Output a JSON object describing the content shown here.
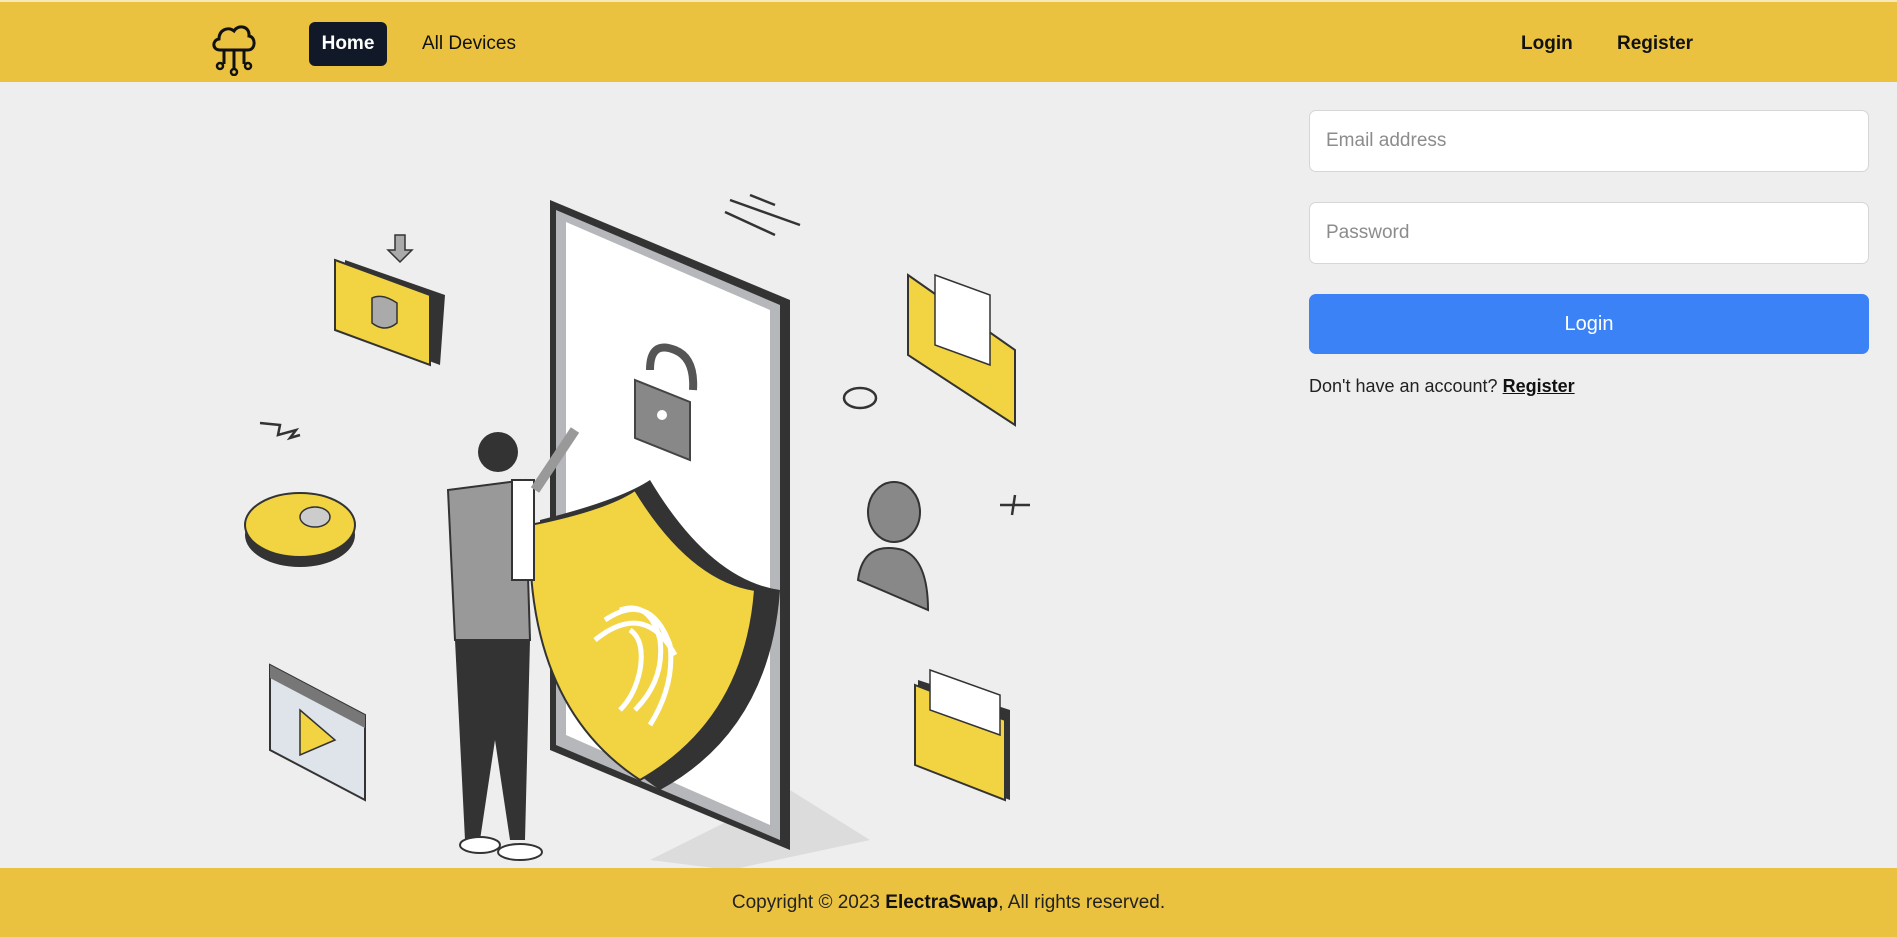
{
  "nav": {
    "logo_icon": "cloud-network-icon",
    "home_label": "Home",
    "devices_label": "All Devices",
    "login_label": "Login",
    "register_label": "Register"
  },
  "hero": {
    "illustration": "mobile-security-fingerprint-illustration"
  },
  "login_form": {
    "email_placeholder": "Email address",
    "password_placeholder": "Password",
    "submit_label": "Login",
    "signup_prompt": "Don't have an account?",
    "signup_link": "Register"
  },
  "footer": {
    "copyright_prefix": "Copyright © 2023",
    "brand": "ElectraSwap",
    "rights": ", All rights reserved."
  },
  "colors": {
    "bar": "#ebc240",
    "accent_button": "#3b82f6",
    "nav_active": "#111827",
    "background": "#eeeeee"
  }
}
